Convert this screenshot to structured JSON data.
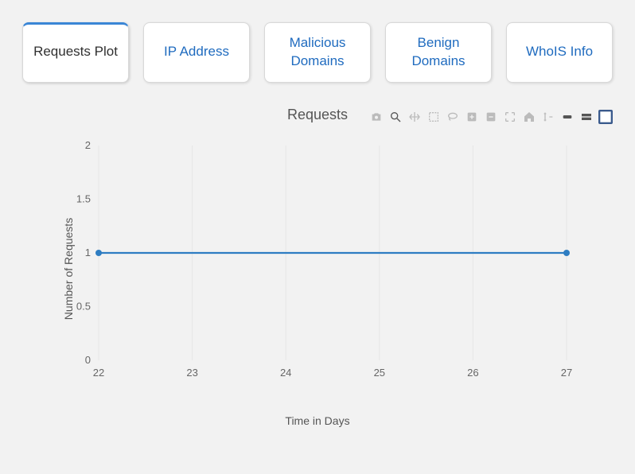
{
  "tabs": [
    {
      "label": "Requests Plot",
      "active": true
    },
    {
      "label": "IP Address",
      "active": false
    },
    {
      "label": "Malicious Domains",
      "active": false
    },
    {
      "label": "Benign Domains",
      "active": false
    },
    {
      "label": "WhoIS Info",
      "active": false
    }
  ],
  "toolbar_icons": [
    "camera-icon",
    "zoom-icon",
    "pan-icon",
    "box-select-icon",
    "lasso-icon",
    "zoom-in-icon",
    "zoom-out-icon",
    "autoscale-icon",
    "home-icon",
    "spike-icon",
    "compare-icon",
    "closest-icon",
    "plotly-logo-icon"
  ],
  "chart_data": {
    "type": "line",
    "title": "Requests",
    "xlabel": "Time in Days",
    "ylabel": "Number of Requests",
    "x": [
      22,
      23,
      24,
      25,
      26,
      27
    ],
    "x_ticks": [
      22,
      23,
      24,
      25,
      26,
      27
    ],
    "y_ticks": [
      0,
      0.5,
      1,
      1.5,
      2
    ],
    "xlim": [
      22,
      27
    ],
    "ylim": [
      0,
      2
    ],
    "series": [
      {
        "name": "Requests",
        "x": [
          22,
          27
        ],
        "values": [
          1,
          1
        ]
      }
    ]
  }
}
